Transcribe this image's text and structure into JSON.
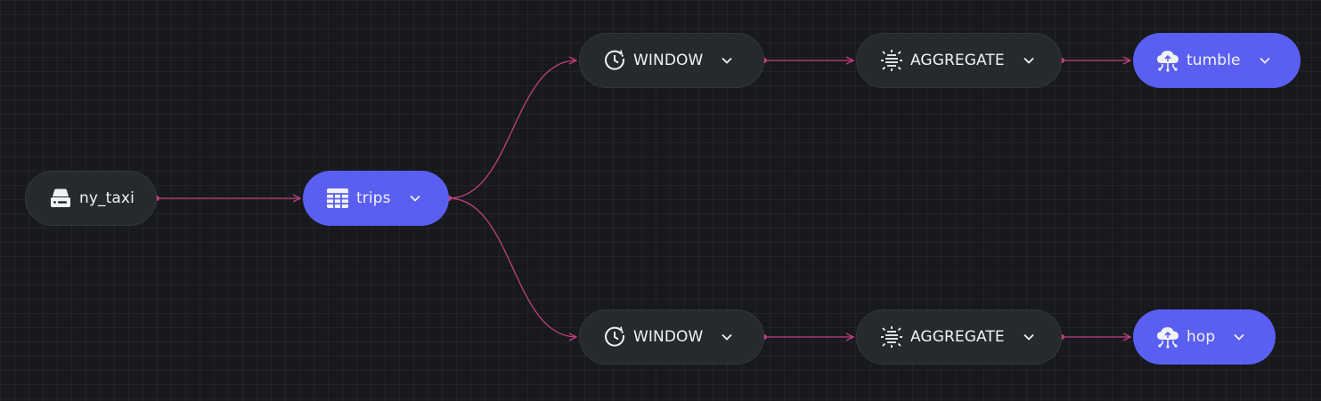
{
  "canvas": {
    "theme": "dark"
  },
  "colors": {
    "edge": "#c0407f",
    "node_dark": "#272a2d",
    "node_accent": "#5a5ff2"
  },
  "nodes": {
    "source": {
      "label": "ny_taxi",
      "icon": "storage-drive-icon"
    },
    "table": {
      "label": "trips",
      "icon": "table-icon"
    },
    "window_top": {
      "label": "WINDOW",
      "icon": "clock-window-icon"
    },
    "aggregate_top": {
      "label": "AGGREGATE",
      "icon": "aggregate-icon"
    },
    "sink_top": {
      "label": "tumble",
      "icon": "cloud-upload-icon"
    },
    "window_bottom": {
      "label": "WINDOW",
      "icon": "clock-window-icon"
    },
    "aggregate_bottom": {
      "label": "AGGREGATE",
      "icon": "aggregate-icon"
    },
    "sink_bottom": {
      "label": "hop",
      "icon": "cloud-upload-icon"
    }
  },
  "edges": [
    [
      "source",
      "table"
    ],
    [
      "table",
      "window_top"
    ],
    [
      "table",
      "window_bottom"
    ],
    [
      "window_top",
      "aggregate_top"
    ],
    [
      "aggregate_top",
      "sink_top"
    ],
    [
      "window_bottom",
      "aggregate_bottom"
    ],
    [
      "aggregate_bottom",
      "sink_bottom"
    ]
  ]
}
